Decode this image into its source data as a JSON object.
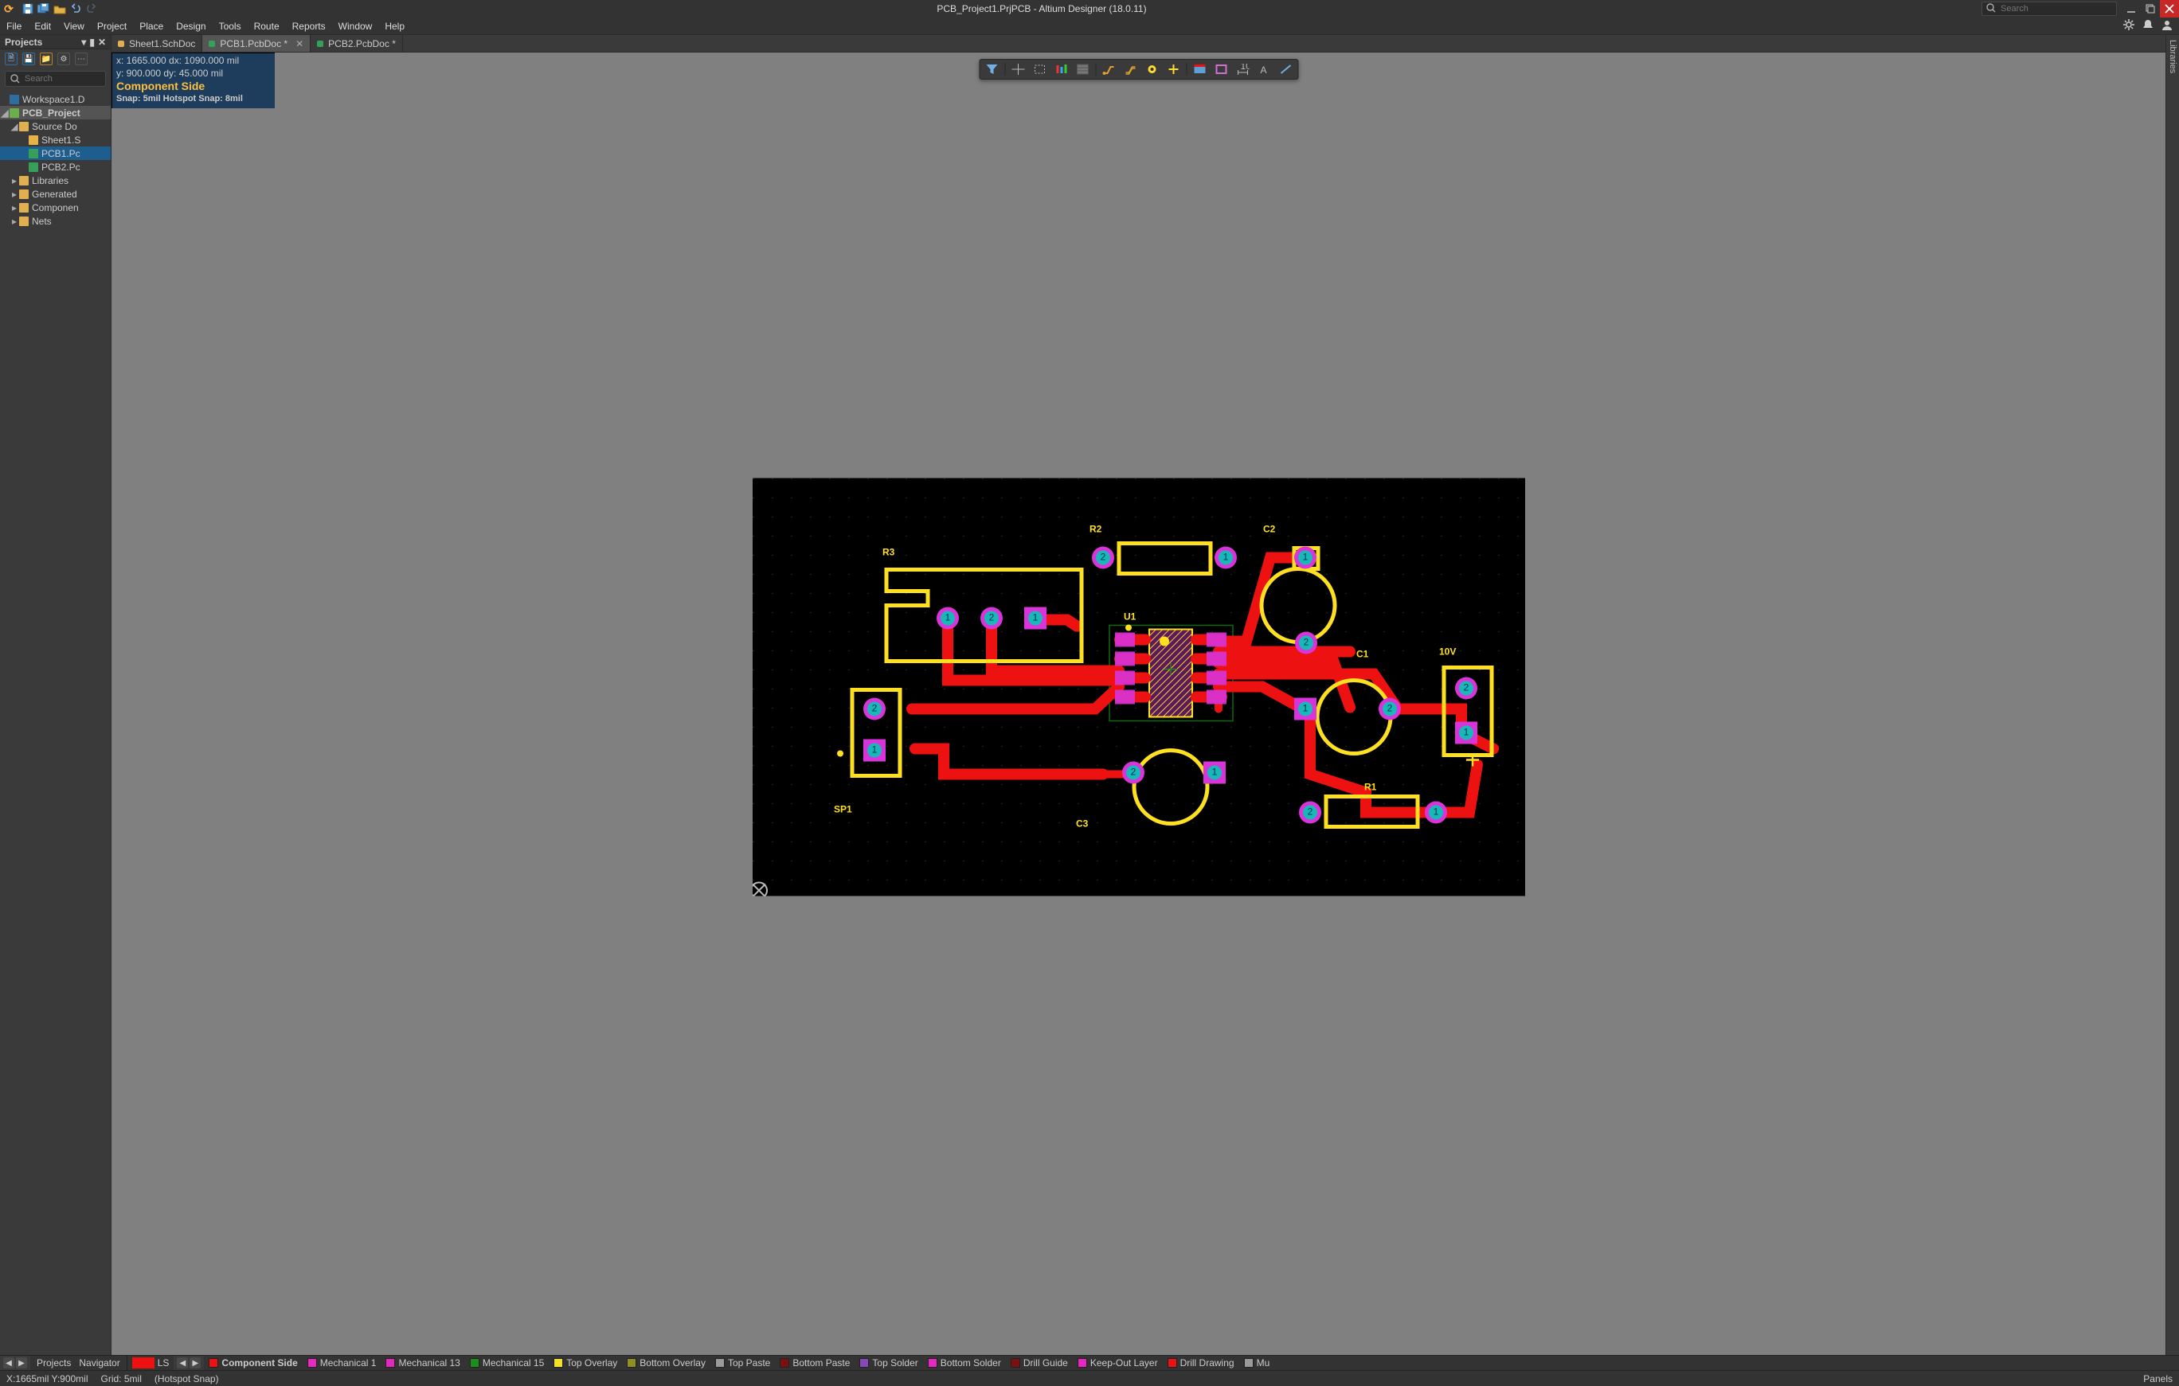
{
  "window_title": "PCB_Project1.PrjPCB - Altium Designer (18.0.11)",
  "search_placeholder": "Search",
  "menus": [
    "File",
    "Edit",
    "View",
    "Project",
    "Place",
    "Design",
    "Tools",
    "Route",
    "Reports",
    "Window",
    "Help"
  ],
  "panel": {
    "title": "Projects",
    "search_placeholder": "Search",
    "workspace": "Workspace1.D",
    "project": "PCB_Project",
    "source_folder": "Source Do",
    "files": [
      "Sheet1.S",
      "PCB1.Pc",
      "PCB2.Pc"
    ],
    "folders": [
      "Libraries",
      "Generated",
      "Componen",
      "Nets"
    ]
  },
  "tabs": [
    {
      "label": "Sheet1.SchDoc",
      "kind": "sch",
      "active": false,
      "dirty": false
    },
    {
      "label": "PCB1.PcbDoc",
      "kind": "pcb",
      "active": true,
      "dirty": true
    },
    {
      "label": "PCB2.PcbDoc",
      "kind": "pcb",
      "active": false,
      "dirty": true
    }
  ],
  "hud": {
    "line1": "x:  1665.000  dx:  1090.000 mil",
    "line2": "y:   900.000   dy:    45.000  mil",
    "cs": "Component Side",
    "snap": "Snap: 5mil Hotspot Snap: 8mil"
  },
  "layerbar": {
    "left_tabs": [
      "Projects",
      "Navigator"
    ],
    "ls": "LS",
    "items": [
      {
        "label": "Component Side",
        "color": "#ee1111",
        "active": true
      },
      {
        "label": "Mechanical 1",
        "color": "#e728c0"
      },
      {
        "label": "Mechanical 13",
        "color": "#e728c0"
      },
      {
        "label": "Mechanical 15",
        "color": "#1a8f1a"
      },
      {
        "label": "Top Overlay",
        "color": "#f5e322"
      },
      {
        "label": "Bottom Overlay",
        "color": "#8f8f22"
      },
      {
        "label": "Top Paste",
        "color": "#9a9a9a"
      },
      {
        "label": "Bottom Paste",
        "color": "#7a1010"
      },
      {
        "label": "Top Solder",
        "color": "#8848b8"
      },
      {
        "label": "Bottom Solder",
        "color": "#e728c0"
      },
      {
        "label": "Drill Guide",
        "color": "#7a1010"
      },
      {
        "label": "Keep-Out Layer",
        "color": "#e728c0"
      },
      {
        "label": "Drill Drawing",
        "color": "#ee1111"
      },
      {
        "label": "Mu",
        "color": "#9a9a9a"
      }
    ]
  },
  "statusbar": {
    "coords": "X:1665mil Y:900mil",
    "grid": "Grid: 5mil",
    "snap": "(Hotspot Snap)",
    "panels": "Panels"
  },
  "libs_label": "Libraries",
  "designators": {
    "R1": "R1",
    "R2": "R2",
    "R3": "R3",
    "C1": "C1",
    "C2": "C2",
    "C3": "C3",
    "U1": "U1",
    "SP1": "SP1",
    "P10V": "10V"
  }
}
